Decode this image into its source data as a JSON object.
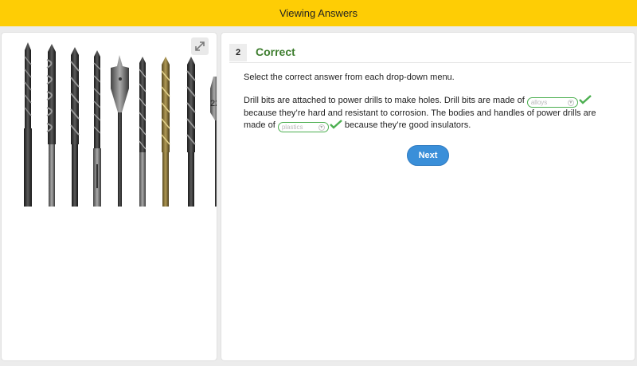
{
  "topbar": {
    "title": "Viewing Answers"
  },
  "question": {
    "number": "2",
    "status": "Correct",
    "instruction": "Select the correct answer from each drop-down menu.",
    "passage": {
      "part1": "Drill bits are attached to power drills to make holes. Drill bits are made of ",
      "dropdown1_value": "alloys",
      "part2": " because they’re hard and resistant to corrosion. The bodies and handles of power drills are made of ",
      "dropdown2_value": "plastics",
      "part3": " because they’re good insulators."
    },
    "next_label": "Next"
  },
  "colors": {
    "topbar": "#fecd05",
    "correct": "#3d7d2e",
    "check": "#4caf50",
    "button": "#3a8fd9"
  },
  "icons": {
    "expand": "expand-arrows-icon",
    "check": "check-icon",
    "dropdown": "chevron-down-icon"
  }
}
